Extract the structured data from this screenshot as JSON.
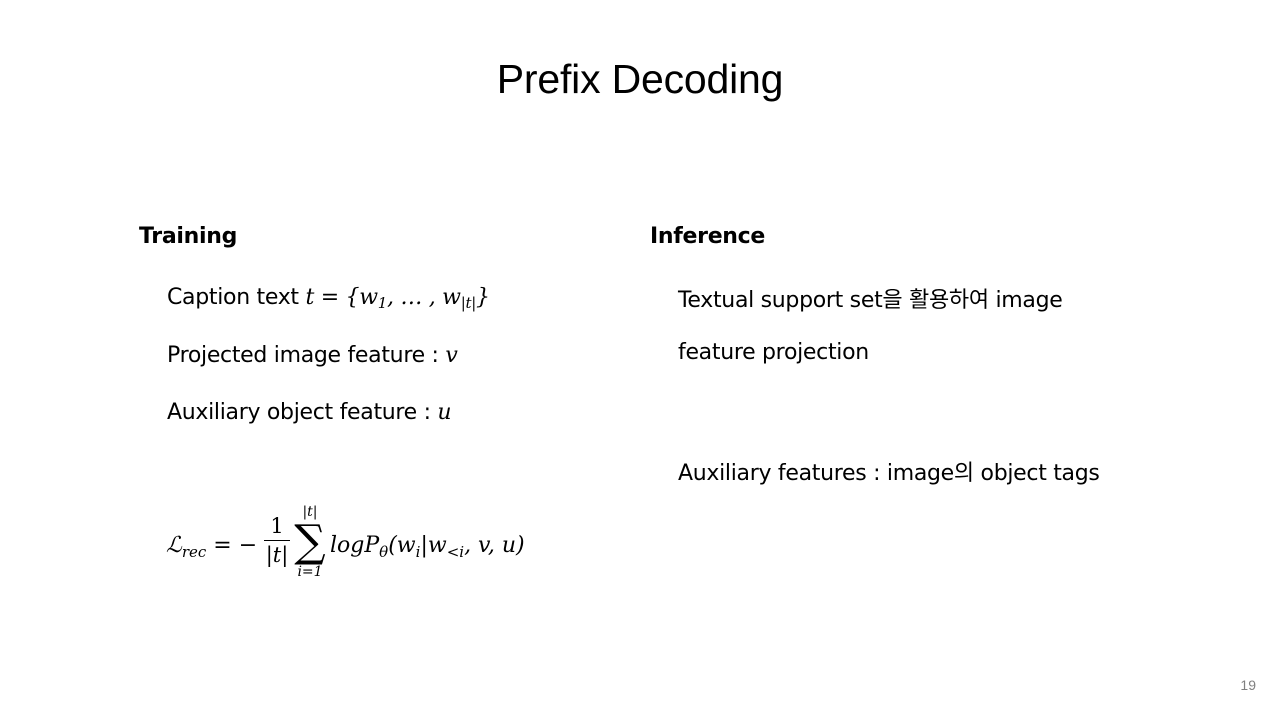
{
  "slide": {
    "title": "Prefix Decoding",
    "page_number": "19"
  },
  "training": {
    "heading": "Training",
    "caption_label": "Caption text ",
    "caption_math": {
      "lhs": "t = {w",
      "sub1": "1",
      "mid": ", … , w",
      "sub2": "|t|",
      "end": "}"
    },
    "projected_label": "Projected image feature : ",
    "projected_var": "v",
    "auxiliary_label": "Auxiliary object feature : ",
    "auxiliary_var": "u",
    "loss": {
      "symbol": "ℒ",
      "symbol_sub": "rec",
      "equals": " = −",
      "frac_num": "1",
      "frac_den": "|t|",
      "sum_upper": "|t|",
      "sum_symbol": "∑",
      "sum_lower": "i=1",
      "body_prefix": "logP",
      "body_sub": "θ",
      "body_open": "(w",
      "body_sub_i": "i",
      "body_mid": "|w",
      "body_sub_lt": "<i",
      "body_end": ", v, u)"
    }
  },
  "inference": {
    "heading": "Inference",
    "line1": "Textual support set을 활용하여 image",
    "line2": "feature projection",
    "line3": "Auxiliary features : image의 object tags"
  }
}
